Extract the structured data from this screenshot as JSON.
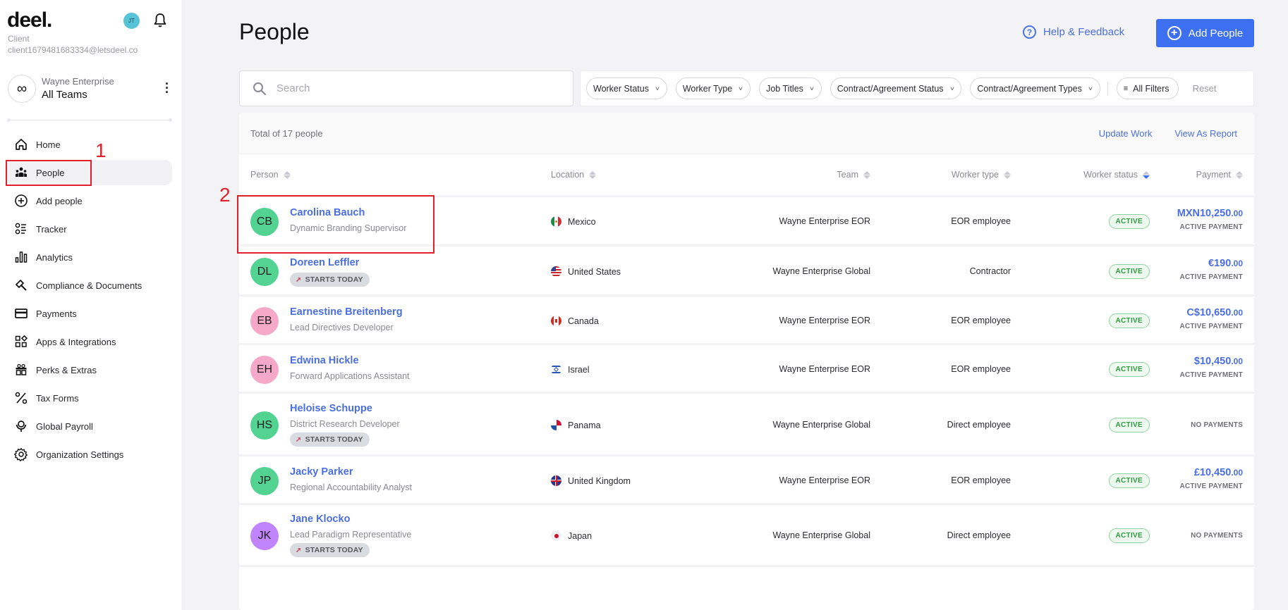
{
  "sidebar": {
    "logo": "deel.",
    "user_initials": "JT",
    "client_role": "Client",
    "client_email": "client1679481683334@letsdeel.co",
    "org_name": "Wayne Enterprise",
    "org_team": "All Teams",
    "items": [
      {
        "label": "Home",
        "icon": "home-icon"
      },
      {
        "label": "People",
        "icon": "people-icon",
        "active": true
      },
      {
        "label": "Add people",
        "icon": "plus-circle-icon"
      },
      {
        "label": "Tracker",
        "icon": "tracker-icon"
      },
      {
        "label": "Analytics",
        "icon": "analytics-icon"
      },
      {
        "label": "Compliance & Documents",
        "icon": "gavel-icon"
      },
      {
        "label": "Payments",
        "icon": "credit-card-icon"
      },
      {
        "label": "Apps & Integrations",
        "icon": "apps-icon"
      },
      {
        "label": "Perks & Extras",
        "icon": "gift-icon"
      },
      {
        "label": "Tax Forms",
        "icon": "percent-icon"
      },
      {
        "label": "Global Payroll",
        "icon": "globe-payroll-icon"
      },
      {
        "label": "Organization Settings",
        "icon": "gear-icon"
      }
    ]
  },
  "annotations": {
    "first": "1",
    "second": "2"
  },
  "header": {
    "title": "People",
    "help_label": "Help & Feedback",
    "add_label": "Add People"
  },
  "search": {
    "placeholder": "Search",
    "value": ""
  },
  "filters": {
    "chips": [
      "Worker Status",
      "Worker Type",
      "Job Titles",
      "Contract/Agreement Status",
      "Contract/Agreement Types"
    ],
    "all_filters": "All Filters",
    "reset": "Reset"
  },
  "summary": {
    "total": "Total of 17 people",
    "update_work": "Update Work",
    "view_report": "View As Report"
  },
  "columns": {
    "person": "Person",
    "location": "Location",
    "team": "Team",
    "worker_type": "Worker type",
    "worker_status": "Worker status",
    "payment": "Payment"
  },
  "colors": {
    "accent": "#3d6ff1",
    "link": "#4a6ee0",
    "active_green": "#2e9c3e",
    "annotation_red": "#e0202a"
  },
  "rows": [
    {
      "initials": "CB",
      "avatar_color": "#52d392",
      "name": "Carolina Bauch",
      "title": "Dynamic Branding Supervisor",
      "starts_today": false,
      "location": "Mexico",
      "flag": "mexico",
      "team": "Wayne Enterprise EOR",
      "worker_type": "EOR employee",
      "status": "ACTIVE",
      "payment_main": "MXN10,250",
      "payment_cents": ".00",
      "payment_label": "ACTIVE PAYMENT"
    },
    {
      "initials": "DL",
      "avatar_color": "#52d392",
      "name": "Doreen Leffler",
      "title": "",
      "starts_today": true,
      "location": "United States",
      "flag": "usa",
      "team": "Wayne Enterprise Global",
      "worker_type": "Contractor",
      "status": "ACTIVE",
      "payment_main": "€190",
      "payment_cents": ".00",
      "payment_label": "ACTIVE PAYMENT"
    },
    {
      "initials": "EB",
      "avatar_color": "#f5a8c8",
      "name": "Earnestine Breitenberg",
      "title": "Lead Directives Developer",
      "starts_today": false,
      "location": "Canada",
      "flag": "canada",
      "team": "Wayne Enterprise EOR",
      "worker_type": "EOR employee",
      "status": "ACTIVE",
      "payment_main": "C$10,650",
      "payment_cents": ".00",
      "payment_label": "ACTIVE PAYMENT"
    },
    {
      "initials": "EH",
      "avatar_color": "#f5a8c8",
      "name": "Edwina Hickle",
      "title": "Forward Applications Assistant",
      "starts_today": false,
      "location": "Israel",
      "flag": "israel",
      "team": "Wayne Enterprise EOR",
      "worker_type": "EOR employee",
      "status": "ACTIVE",
      "payment_main": "$10,450",
      "payment_cents": ".00",
      "payment_label": "ACTIVE PAYMENT"
    },
    {
      "initials": "HS",
      "avatar_color": "#52d392",
      "name": "Heloise Schuppe",
      "title": "District Research Developer",
      "starts_today": true,
      "location": "Panama",
      "flag": "panama",
      "team": "Wayne Enterprise Global",
      "worker_type": "Direct employee",
      "status": "ACTIVE",
      "payment_main": "",
      "payment_cents": "",
      "payment_label": "NO PAYMENTS"
    },
    {
      "initials": "JP",
      "avatar_color": "#52d392",
      "name": "Jacky Parker",
      "title": "Regional Accountability Analyst",
      "starts_today": false,
      "location": "United Kingdom",
      "flag": "uk",
      "team": "Wayne Enterprise EOR",
      "worker_type": "EOR employee",
      "status": "ACTIVE",
      "payment_main": "£10,450",
      "payment_cents": ".00",
      "payment_label": "ACTIVE PAYMENT"
    },
    {
      "initials": "JK",
      "avatar_color": "#c084fc",
      "name": "Jane Klocko",
      "title": "Lead Paradigm Representative",
      "starts_today": true,
      "location": "Japan",
      "flag": "japan",
      "team": "Wayne Enterprise Global",
      "worker_type": "Direct employee",
      "status": "ACTIVE",
      "payment_main": "",
      "payment_cents": "",
      "payment_label": "NO PAYMENTS"
    }
  ],
  "starts_today_label": "STARTS TODAY"
}
